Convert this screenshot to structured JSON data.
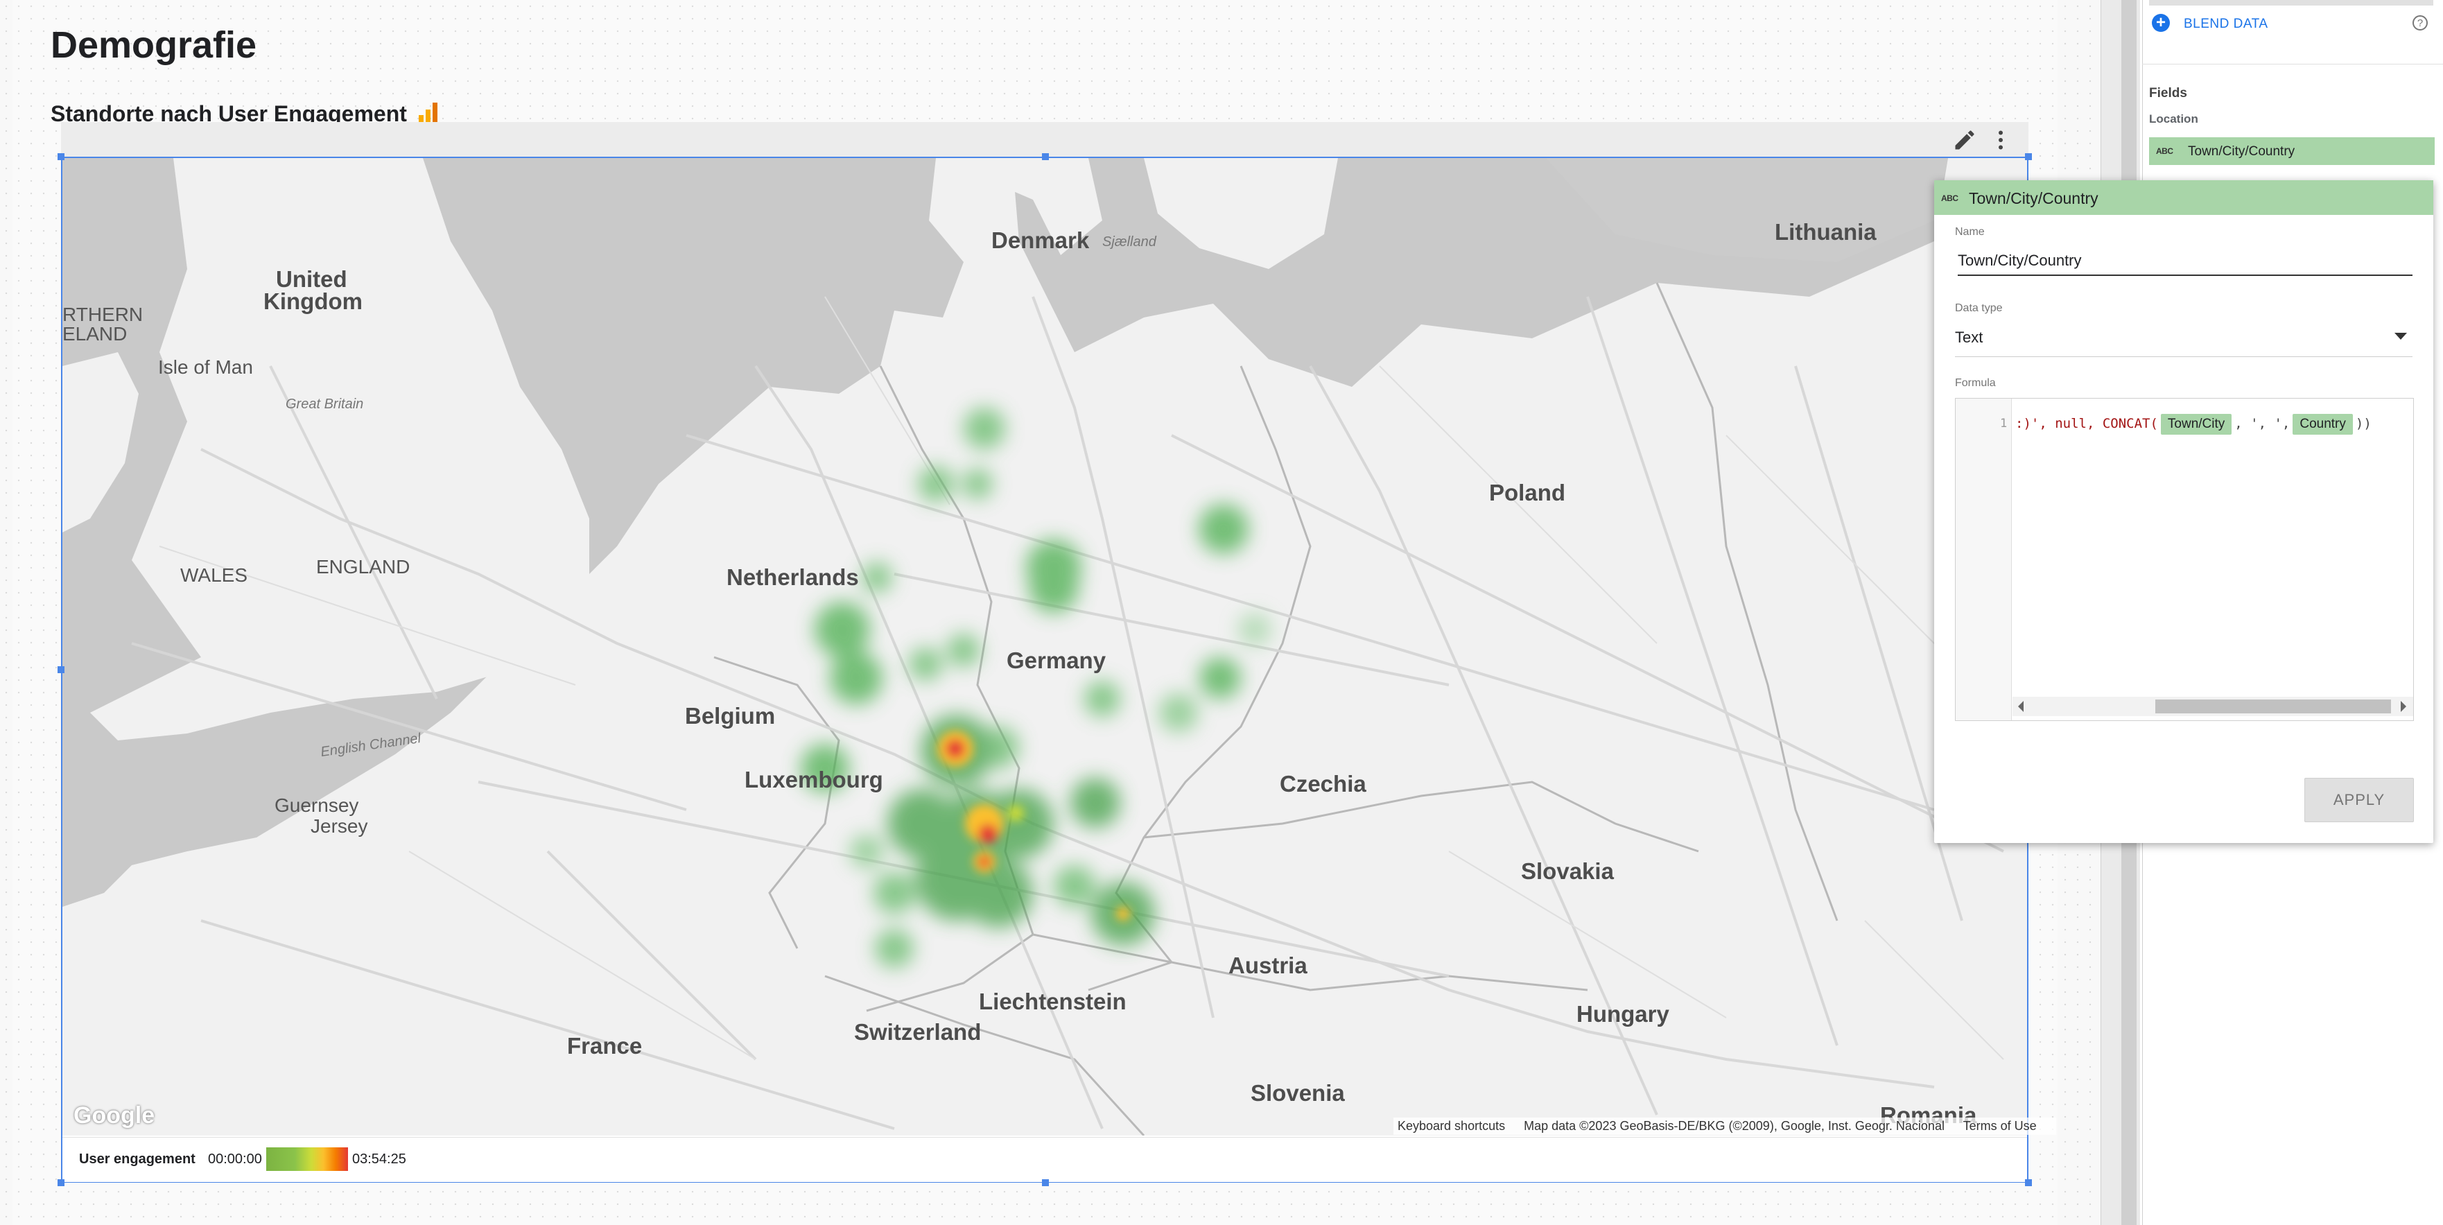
{
  "report": {
    "page_title": "Demografie",
    "chart_title": "Standorte nach User Engagement"
  },
  "map": {
    "labels": {
      "denmark": "Denmark",
      "sjaelland": "Sjælland",
      "lithuania": "Lithuania",
      "united_kingdom_1": "United",
      "united_kingdom_2": "Kingdom",
      "northern_ireland_1": "RTHERN",
      "northern_ireland_2": "ELAND",
      "isle_of_man": "Isle of Man",
      "great_britain": "Great Britain",
      "wales": "WALES",
      "england": "ENGLAND",
      "netherlands": "Netherlands",
      "poland": "Poland",
      "germany": "Germany",
      "belgium": "Belgium",
      "english_channel": "English Channel",
      "luxembourg": "Luxembourg",
      "czechia": "Czechia",
      "guernsey": "Guernsey",
      "jersey": "Jersey",
      "slovakia": "Slovakia",
      "austria": "Austria",
      "liechtenstein": "Liechtenstein",
      "switzerland": "Switzerland",
      "france": "France",
      "hungary": "Hungary",
      "slovenia": "Slovenia",
      "romania": "Romania",
      "google": "Google"
    },
    "footer": {
      "shortcuts": "Keyboard shortcuts",
      "attribution": "Map data ©2023 GeoBasis-DE/BKG (©2009), Google, Inst. Geogr. Nacional",
      "terms": "Terms of Use"
    }
  },
  "legend": {
    "title": "User engagement",
    "min": "00:00:00",
    "max": "03:54:25"
  },
  "panel": {
    "blend_label": "BLEND DATA",
    "help": "?",
    "fields_label": "Fields",
    "location_label": "Location",
    "field_type": "ABC",
    "field_name": "Town/City/Country"
  },
  "popover": {
    "type": "ABC",
    "header": "Town/City/Country",
    "name_label": "Name",
    "name_value": "Town/City/Country",
    "data_type_label": "Data type",
    "data_type_value": "Text",
    "formula_label": "Formula",
    "line_number": "1",
    "code_prefix": ":)', null, CONCAT(",
    "token_1": "Town/City",
    "code_sep": ", ', ',",
    "token_2": "Country",
    "code_suffix": "))",
    "apply": "APPLY"
  },
  "colors": {
    "accent": "#4a86e8",
    "field_green": "#a8d5a8",
    "link_blue": "#1a73e8"
  }
}
